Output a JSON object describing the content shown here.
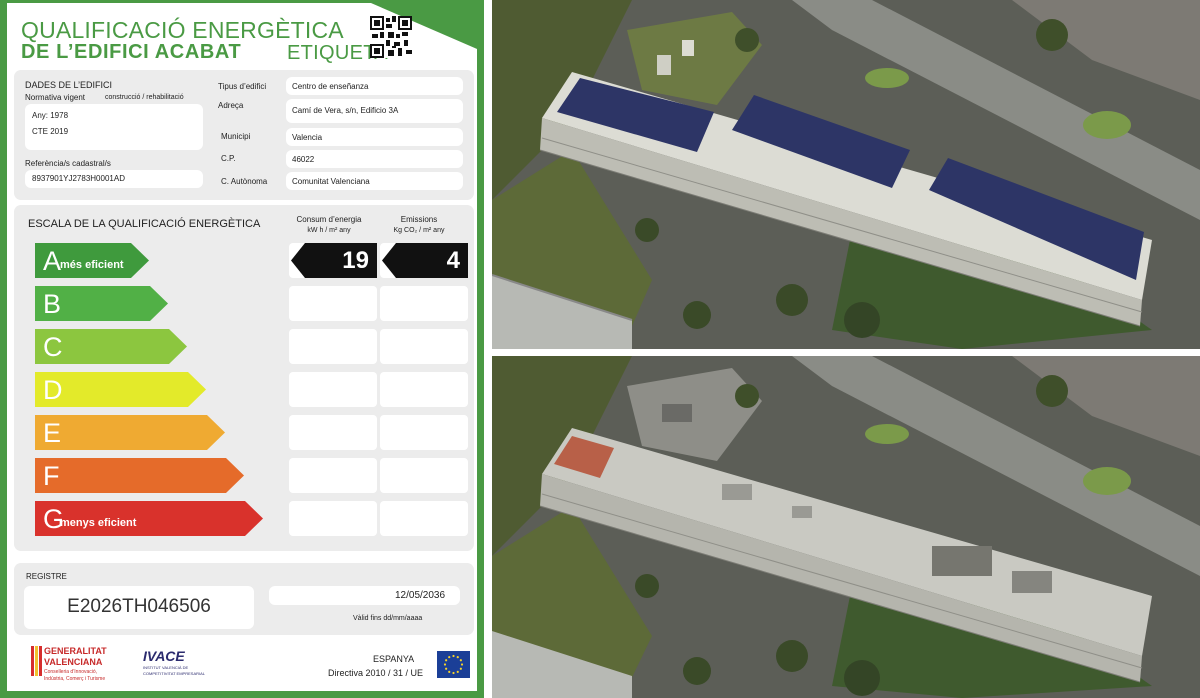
{
  "label": {
    "title_line1": "QUALIFICACIÓ ENERGÈTICA",
    "title_line2": "DE L’EDIFICI ACABAT",
    "title_etiqueta": "ETIQUETA",
    "building_data": {
      "section_title": "DADES DE L’EDIFICI",
      "normativa_label": "Normativa vigent",
      "normativa_sub": "construcció / rehabilitació",
      "year": "Any: 1978",
      "code": "CTE 2019",
      "cadastral_label": "Referència/s cadastral/s",
      "cadastral_value": "8937901YJ2783H0001AD",
      "fields": [
        {
          "label": "Tipus d’edifici",
          "value": "Centro de enseñanza"
        },
        {
          "label": "Adreça",
          "value": "Camí de Vera, s/n, Edificio 3A"
        },
        {
          "label": "Municipi",
          "value": "Valencia"
        },
        {
          "label": "C.P.",
          "value": "46022"
        },
        {
          "label": "C. Autònoma",
          "value": "Comunitat Valenciana"
        }
      ]
    },
    "scale": {
      "title": "ESCALA DE LA QUALIFICACIÓ ENERGÈTICA",
      "consum_header": "Consum d’energia",
      "consum_units": "kW h / m² any",
      "emissions_header": "Emissions",
      "emissions_units": "Kg CO₂ / m² any",
      "classes": [
        {
          "letter": "A",
          "sub": "més eficient",
          "color": "#3f9a3d"
        },
        {
          "letter": "B",
          "sub": "",
          "color": "#51b046"
        },
        {
          "letter": "C",
          "sub": "",
          "color": "#8cc63f"
        },
        {
          "letter": "D",
          "sub": "",
          "color": "#e3ea2a"
        },
        {
          "letter": "E",
          "sub": "",
          "color": "#efaa32"
        },
        {
          "letter": "F",
          "sub": "",
          "color": "#e56b2a"
        },
        {
          "letter": "G",
          "sub": "menys eficient",
          "color": "#d9322c"
        }
      ],
      "consum_value": "19",
      "emissions_value": "4",
      "rated_class": "A"
    },
    "registre": {
      "label": "REGISTRE",
      "number": "E2026TH046506",
      "date": "12/05/2036",
      "valid_label": "Vàlid fins dd/mm/aaaa"
    },
    "footer": {
      "gva_line1": "GENERALITAT",
      "gva_line2": "VALENCIANA",
      "gva_sub1": "Conselleria d’Innovació,",
      "gva_sub2": "Indústria, Comerç i Turisme",
      "ivace": "IVACE",
      "ivace_sub1": "INSTITUT VALENCIÀ DE",
      "ivace_sub2": "COMPETITIVITAT EMPRESARIAL",
      "country": "ESPANYA",
      "directive": "Directiva 2010 / 31 / UE"
    }
  },
  "colors": {
    "border_green": "#4a9a44",
    "panel_gray": "#ececec"
  }
}
